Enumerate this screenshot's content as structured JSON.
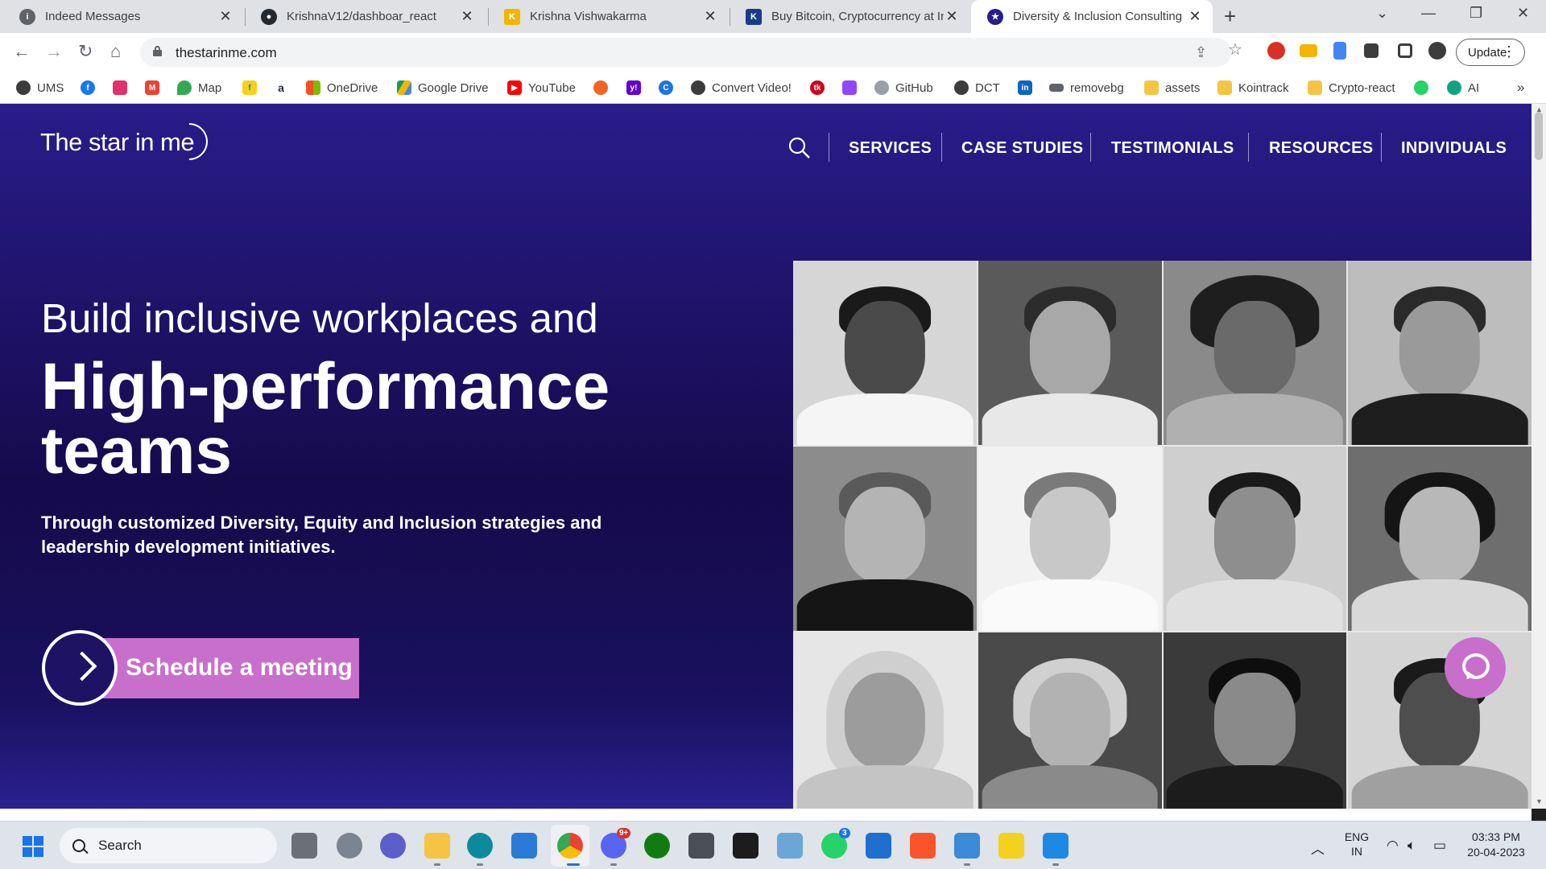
{
  "browser": {
    "tabs": [
      {
        "title": "Indeed Messages",
        "favicon_color": "#5f6368",
        "favicon": "indeed-icon"
      },
      {
        "title": "KrishnaV12/dashboar_react",
        "favicon_color": "#24292f",
        "favicon": "github-icon"
      },
      {
        "title": "Krishna Vishwakarma",
        "favicon_color": "#f4b400",
        "favicon": "portfolio-icon"
      },
      {
        "title": "Buy Bitcoin, Cryptocurrency at In",
        "favicon_color": "#1a3a8a",
        "favicon": "crypto-exchange-icon"
      },
      {
        "title": "Diversity & Inclusion Consulting",
        "favicon_color": "#2a1c8a",
        "favicon": "starinme-icon"
      }
    ],
    "url": "thestarinme.com",
    "update_label": "Update",
    "bookmarks": [
      {
        "label": "UMS",
        "color": "#3c3c3c"
      },
      {
        "label": "",
        "color": "#1877f2",
        "icon": "facebook-icon"
      },
      {
        "label": "",
        "color": "#e1306c",
        "icon": "instagram-icon"
      },
      {
        "label": "",
        "color": "#ea4335",
        "icon": "gmail-icon"
      },
      {
        "label": "Map",
        "color": "#34a853"
      },
      {
        "label": "",
        "color": "#f7d117",
        "icon": "flipkart-icon"
      },
      {
        "label": "",
        "color": "#232f3e",
        "icon": "amazon-icon"
      },
      {
        "label": "OneDrive",
        "color": "#f25022"
      },
      {
        "label": "Google Drive",
        "color": "#0f9d58"
      },
      {
        "label": "YouTube",
        "color": "#ff0000"
      },
      {
        "label": "",
        "color": "#f26522",
        "icon": "codepen-icon"
      },
      {
        "label": "",
        "color": "#6001d2",
        "icon": "yahoo-icon"
      },
      {
        "label": "",
        "color": "#1a73e8",
        "icon": "c-icon"
      },
      {
        "label": "Convert Video!",
        "color": "#3c3c3c"
      },
      {
        "label": "",
        "color": "#d0021b",
        "icon": "tk-icon"
      },
      {
        "label": "",
        "color": "#9146ff",
        "icon": "twitch-icon"
      },
      {
        "label": "GitHub",
        "color": "#9aa0a6"
      },
      {
        "label": "DCT",
        "color": "#3c3c3c"
      },
      {
        "label": "",
        "color": "#0a66c2",
        "icon": "linkedin-icon"
      },
      {
        "label": "removebg",
        "color": "#5f6368"
      },
      {
        "label": "assets",
        "color": "#f4c542"
      },
      {
        "label": "Kointrack",
        "color": "#f4c542"
      },
      {
        "label": "Crypto-react",
        "color": "#f4c542"
      },
      {
        "label": "",
        "color": "#25d366",
        "icon": "whatsapp-icon"
      },
      {
        "label": "AI",
        "color": "#10a37f"
      }
    ],
    "more_bookmarks": "»"
  },
  "site": {
    "logo_text": "The star in me",
    "nav": [
      "SERVICES",
      "CASE STUDIES",
      "TESTIMONIALS",
      "RESOURCES",
      "INDIVIDUALS"
    ],
    "hero_sub": "Build inclusive workplaces and",
    "hero_title": "High-performance teams",
    "hero_desc": "Through customized Diversity, Equity and Inclusion strategies and leadership development initiatives.",
    "cta_label": "Schedule a meeting",
    "accent_color": "#c86fcc"
  },
  "taskbar": {
    "search_label": "Search",
    "lang_top": "ENG",
    "lang_bottom": "IN",
    "time": "03:33 PM",
    "date": "20-04-2023",
    "discord_badge": "9+",
    "whatsapp_badge": "3"
  }
}
